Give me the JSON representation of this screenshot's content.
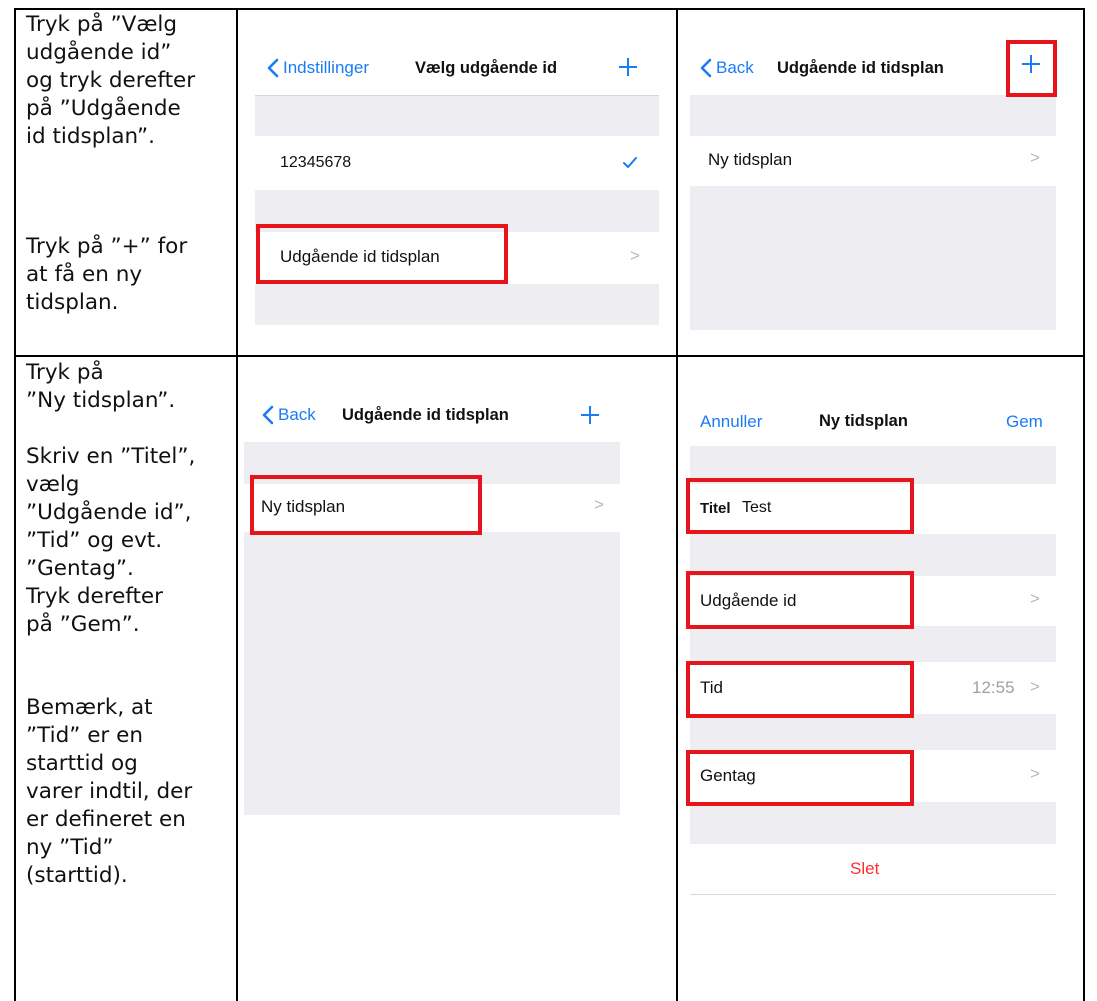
{
  "instructions": [
    "Tryk på ”Vælg udgående id” og tryk derefter på ”Udgående id tidsplan”.",
    "Tryk på ”+” for at få en ny tidsplan.",
    "Tryk på ”Ny tidsplan”.",
    "Skriv en ”Titel”, vælg ”Udgående id”, ”Tid” og evt. ”Gentag”. Tryk derefter på ”Gem”.",
    "Bemærk, at ”Tid” er en starttid og varer indtil, der er defineret en ny ”Tid” (starttid)."
  ],
  "screen1": {
    "back_label": "Indstillinger",
    "title": "Vælg udgående id",
    "number": "12345678",
    "schedule_item": "Udgående id tidsplan"
  },
  "screen2": {
    "back_label": "Back",
    "title": "Udgående id tidsplan",
    "item": "Ny tidsplan"
  },
  "screen3": {
    "back_label": "Back",
    "title": "Udgående id tidsplan",
    "item": "Ny tidsplan"
  },
  "screen4": {
    "cancel_label": "Annuller",
    "title": "Ny tidsplan",
    "save_label": "Gem",
    "title_field_label": "Titel",
    "title_field_value": "Test",
    "outgoing_id_label": "Udgående id",
    "time_label": "Tid",
    "time_value": "12:55",
    "repeat_label": "Gentag",
    "delete_label": "Slet"
  },
  "colors": {
    "ios_blue": "#1a7cf5",
    "highlight_red": "#e8141b",
    "group_gray": "#eeeef2",
    "delete_red": "#ff2d2d"
  }
}
